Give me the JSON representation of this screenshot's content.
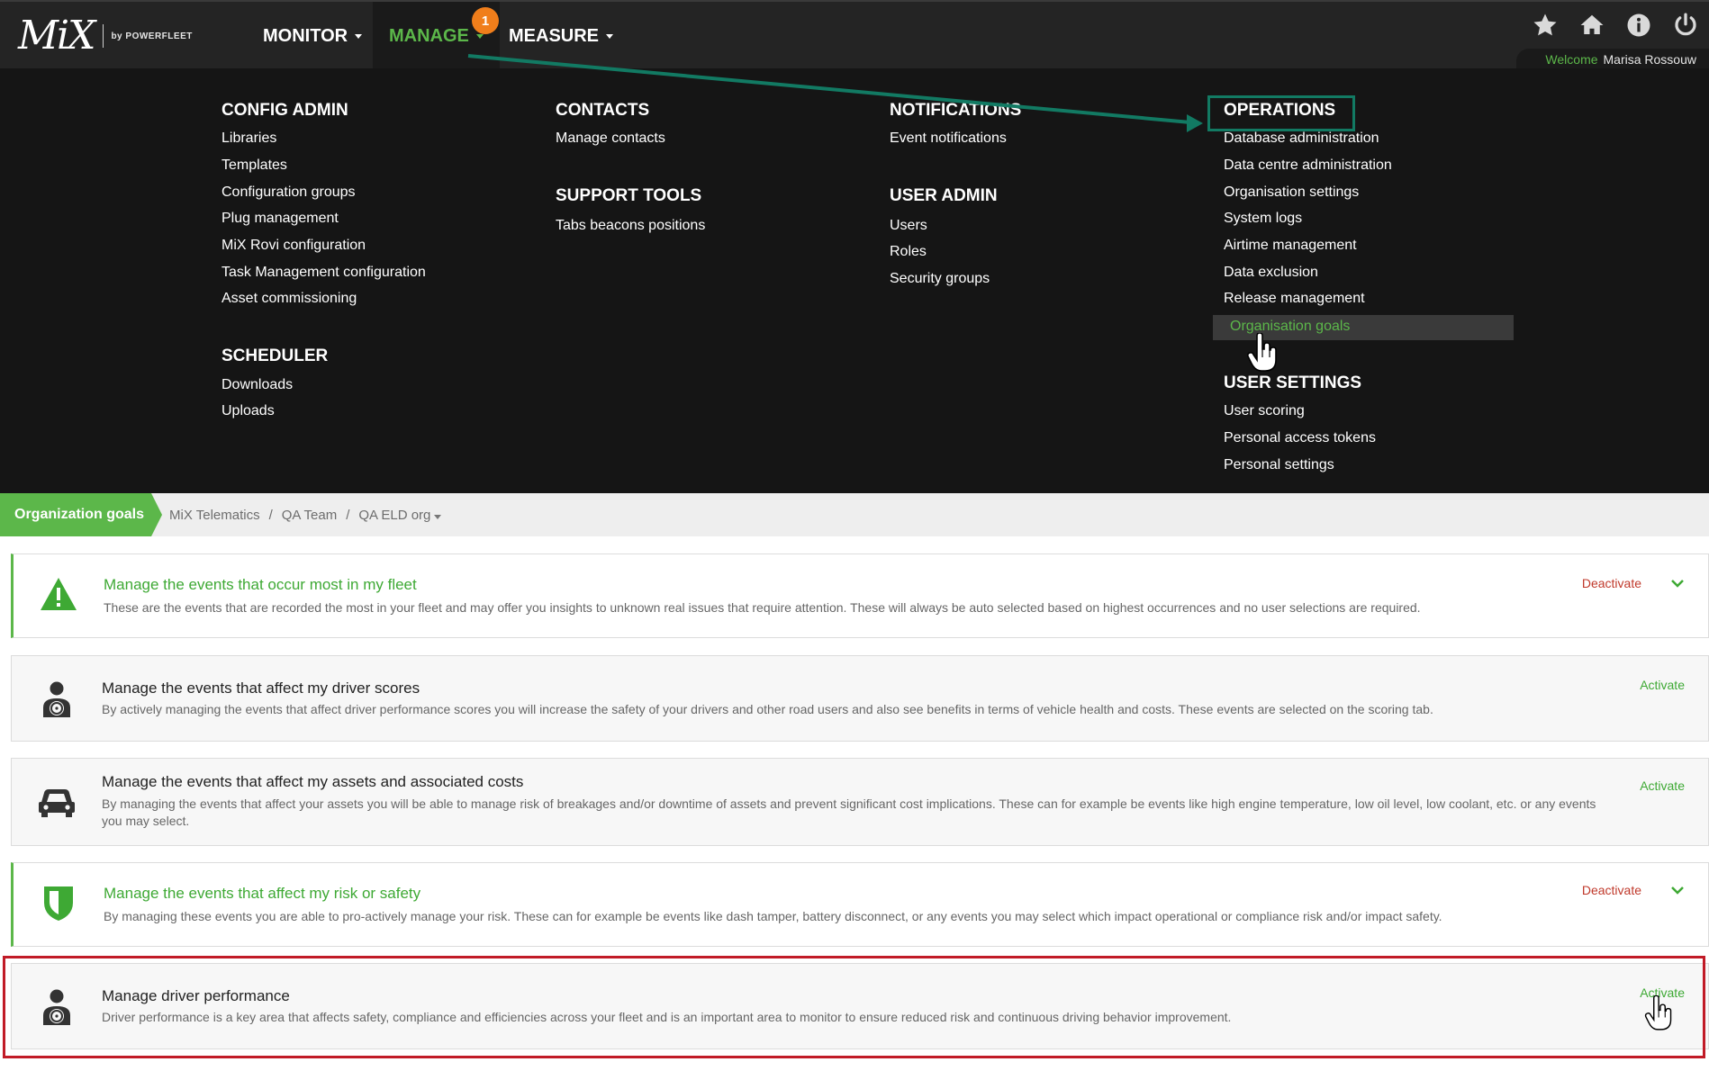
{
  "app": {
    "logo_text": "MiX",
    "logo_by": "by POWERFLEET"
  },
  "nav": {
    "monitor": "MONITOR",
    "manage": "MANAGE",
    "measure": "MEASURE",
    "manage_badge": "1"
  },
  "header": {
    "icons": [
      "star-icon",
      "home-icon",
      "info-icon",
      "power-icon"
    ],
    "welcome_label": "Welcome",
    "user_name": "Marisa Rossouw"
  },
  "menu": {
    "config_admin": {
      "title": "CONFIG ADMIN",
      "items": [
        "Libraries",
        "Templates",
        "Configuration groups",
        "Plug management",
        "MiX Rovi configuration",
        "Task Management configuration",
        "Asset commissioning"
      ]
    },
    "scheduler": {
      "title": "SCHEDULER",
      "items": [
        "Downloads",
        "Uploads"
      ]
    },
    "contacts": {
      "title": "CONTACTS",
      "items": [
        "Manage contacts"
      ]
    },
    "support_tools": {
      "title": "SUPPORT TOOLS",
      "items": [
        "Tabs beacons positions"
      ]
    },
    "notifications": {
      "title": "NOTIFICATIONS",
      "items": [
        "Event notifications"
      ]
    },
    "user_admin": {
      "title": "USER ADMIN",
      "items": [
        "Users",
        "Roles",
        "Security groups"
      ]
    },
    "operations": {
      "title": "OPERATIONS",
      "items": [
        "Database administration",
        "Data centre administration",
        "Organisation settings",
        "System logs",
        "Airtime management",
        "Data exclusion",
        "Release management",
        "Organisation goals"
      ],
      "highlighted": "Organisation goals"
    },
    "user_settings": {
      "title": "USER SETTINGS",
      "items": [
        "User scoring",
        "Personal access tokens",
        "Personal settings"
      ]
    }
  },
  "breadcrumb": {
    "page_tab": "Organization goals",
    "path": [
      "MiX Telematics",
      "QA Team",
      "QA ELD org"
    ],
    "separator": "/"
  },
  "goals": [
    {
      "icon": "warning-icon",
      "title": "Manage the events that occur most in my fleet",
      "description": "These are the events that are recorded the most in your fleet and may offer you insights to unknown real issues that require attention. These will always be auto selected based on highest occurrences and no user selections are required.",
      "action": "Deactivate",
      "active": true
    },
    {
      "icon": "driver-icon",
      "title": "Manage the events that affect my driver scores",
      "description": "By actively managing the events that affect driver performance scores you will increase the safety of your drivers and other road users and also see benefits in terms of vehicle health and costs. These events are selected on the scoring tab.",
      "action": "Activate",
      "active": false
    },
    {
      "icon": "car-icon",
      "title": "Manage the events that affect my assets and associated costs",
      "description": "By managing the events that affect your assets you will be able to manage risk of breakages and/or downtime of assets and prevent significant cost implications. These can for example be events like high engine temperature, low oil level, low coolant, etc. or any events you may select.",
      "action": "Activate",
      "active": false
    },
    {
      "icon": "shield-icon",
      "title": "Manage the events that affect my risk or safety",
      "description": "By managing these events you are able to pro-actively manage your risk. These can for example be events like dash tamper, battery disconnect, or any events you may select which impact operational or compliance risk and/or impact safety.",
      "action": "Deactivate",
      "active": true
    },
    {
      "icon": "driver-icon",
      "title": "Manage driver performance",
      "description": "Driver performance is a key area that affects safety, compliance and efficiencies across your fleet and is an important area to monitor to ensure reduced risk and continuous driving behavior improvement.",
      "action": "Activate",
      "active": false
    }
  ],
  "colors": {
    "accent_green": "#5cb74a",
    "deactivate_red": "#c0392b",
    "annotation_teal": "#127a63",
    "annotation_red": "#c11b27",
    "badge_orange": "#f07e1b"
  }
}
